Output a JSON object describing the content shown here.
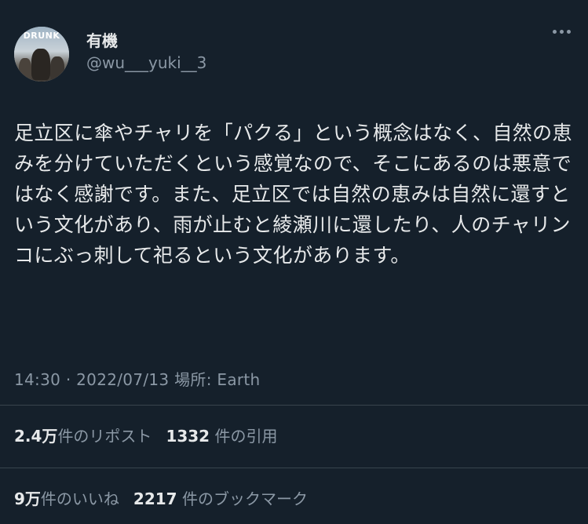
{
  "profile": {
    "avatar_text": "DRUNK",
    "display_name": "有機",
    "handle": "@wu___yuki__3"
  },
  "tweet": {
    "text": "足立区に傘やチャリを「パクる」という概念はなく、自然の恵みを分けていただくという感覚なので、そこにあるのは悪意ではなく感謝です。また、足立区では自然の恵みは自然に還すという文化があり、雨が止むと綾瀬川に還したり、人のチャリンコにぶっ刺して祀るという文化があります。"
  },
  "meta": {
    "time": "14:30",
    "separator": "·",
    "date": "2022/07/13",
    "location": "場所: Earth"
  },
  "stats": {
    "reposts_count": "2.4万",
    "reposts_label": "件のリポスト",
    "quotes_count": "1332",
    "quotes_label": "件の引用",
    "likes_count": "9万",
    "likes_label": "件のいいね",
    "bookmarks_count": "2217",
    "bookmarks_label": "件のブックマーク"
  },
  "icons": {
    "more": "more-options-icon"
  }
}
